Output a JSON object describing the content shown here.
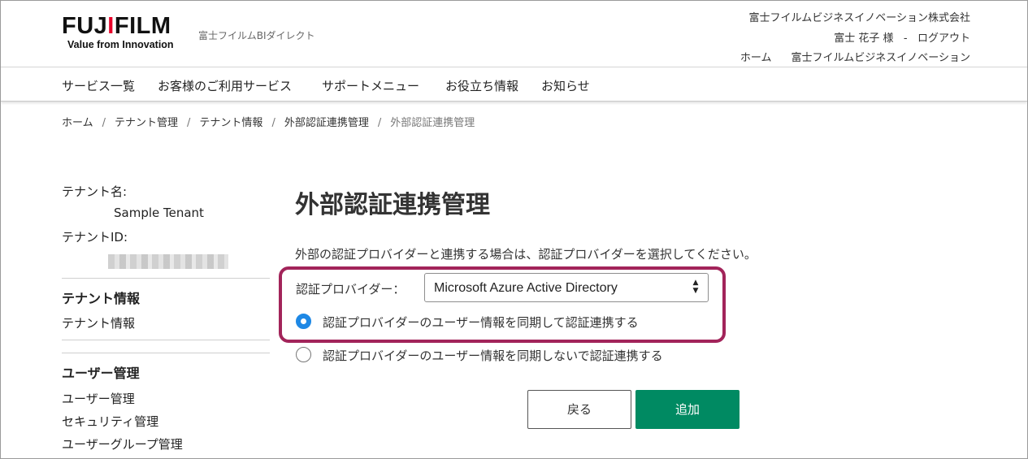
{
  "header": {
    "logo_prefix": "FUJ",
    "logo_accent": "I",
    "logo_suffix": "FILM",
    "logo_tagline": "Value from Innovation",
    "site_name": "富士フイルムBIダイレクト",
    "company": "富士フイルムビジネスイノベーション株式会社",
    "user_line": "富士 花子 様   -   ログアウト",
    "home_link": "ホーム",
    "company_link": "富士フイルムビジネスイノベーション"
  },
  "nav": {
    "items": [
      "サービス一覧",
      "お客様のご利用サービス",
      "サポートメニュー",
      "お役立ち情報",
      "お知らせ"
    ]
  },
  "breadcrumb": {
    "items": [
      "ホーム",
      "テナント管理",
      "テナント情報",
      "外部認証連携管理"
    ],
    "current": "外部認証連携管理",
    "separator": "/"
  },
  "sidebar": {
    "tenant_name_label": "テナント名:",
    "tenant_name": "Sample Tenant",
    "tenant_id_label": "テナントID:",
    "sections": [
      {
        "title": "テナント情報",
        "links": [
          "テナント情報"
        ]
      },
      {
        "title": "ユーザー管理",
        "links": [
          "ユーザー管理",
          "セキュリティ管理",
          "ユーザーグループ管理"
        ]
      }
    ]
  },
  "main": {
    "title": "外部認証連携管理",
    "description": "外部の認証プロバイダーと連携する場合は、認証プロバイダーを選択してください。",
    "provider_label": "認証プロバイダー：",
    "provider_value": "Microsoft Azure Active Directory",
    "radio_options": [
      {
        "label": "認証プロバイダーのユーザー情報を同期して認証連携する",
        "selected": true
      },
      {
        "label": "認証プロバイダーのユーザー情報を同期しないで認証連携する",
        "selected": false
      }
    ],
    "back_button": "戻る",
    "add_button": "追加"
  },
  "colors": {
    "brand_red": "#e8002a",
    "highlight": "#a2245a",
    "primary_button": "#008a62",
    "radio_selected": "#1e88e5"
  }
}
